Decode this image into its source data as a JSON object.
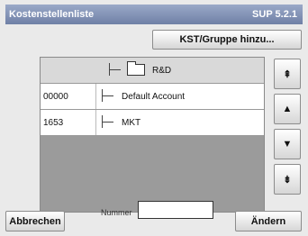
{
  "window": {
    "title": "Kostenstellenliste",
    "version": "SUP 5.2.1"
  },
  "toolbar": {
    "kst_button_label": "KST/Gruppe hinzu..."
  },
  "list": {
    "header_label": "R&D",
    "rows": [
      {
        "number": "00000",
        "name": "Default Account"
      },
      {
        "number": "1653",
        "name": "MKT"
      }
    ]
  },
  "scroll": {
    "top": "⇞",
    "up": "▲",
    "down": "▼",
    "bottom": "⇟"
  },
  "footer": {
    "number_label": "Nummer",
    "number_value": "",
    "cancel_label": "Abbrechen",
    "change_label": "Ändern"
  }
}
